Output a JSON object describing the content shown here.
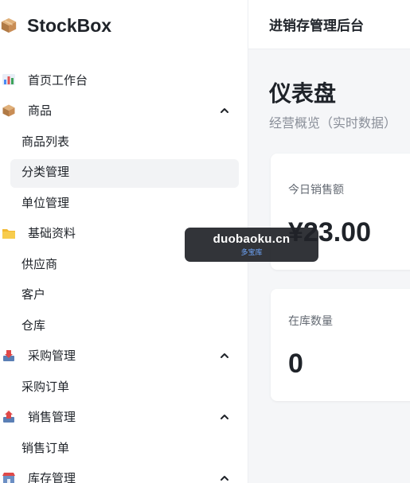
{
  "brand": {
    "name": "StockBox",
    "icon": "package-box-icon"
  },
  "nav": {
    "home": {
      "label": "首页工作台",
      "icon": "bar-chart-icon"
    },
    "products": {
      "label": "商品",
      "icon": "package-box-icon",
      "expanded": true,
      "children": [
        "商品列表",
        "分类管理",
        "单位管理"
      ],
      "active_child": "分类管理"
    },
    "basic": {
      "label": "基础资料",
      "icon": "folder-icon",
      "children": [
        "供应商",
        "客户",
        "仓库"
      ]
    },
    "purchase": {
      "label": "采购管理",
      "icon": "inbox-tray-icon",
      "expanded": true,
      "children": [
        "采购订单"
      ]
    },
    "sales": {
      "label": "销售管理",
      "icon": "outbox-tray-icon",
      "expanded": true,
      "children": [
        "销售订单"
      ]
    },
    "inventory": {
      "label": "库存管理",
      "icon": "store-icon",
      "expanded": true
    }
  },
  "header": {
    "title": "进销存管理后台"
  },
  "page": {
    "title": "仪表盘",
    "subtitle": "经营概览（实时数据）"
  },
  "cards": {
    "sales_today": {
      "label": "今日销售额",
      "value": "¥23.00"
    },
    "stock_qty": {
      "label": "在库数量",
      "value": "0"
    }
  },
  "watermark": {
    "main": "duobaoku.cn",
    "sub": "多宝库"
  },
  "colors": {
    "accent": "#1f2329",
    "muted": "#8a8f99",
    "active_bg": "#f2f3f5",
    "watermark_bg": "#212328"
  }
}
